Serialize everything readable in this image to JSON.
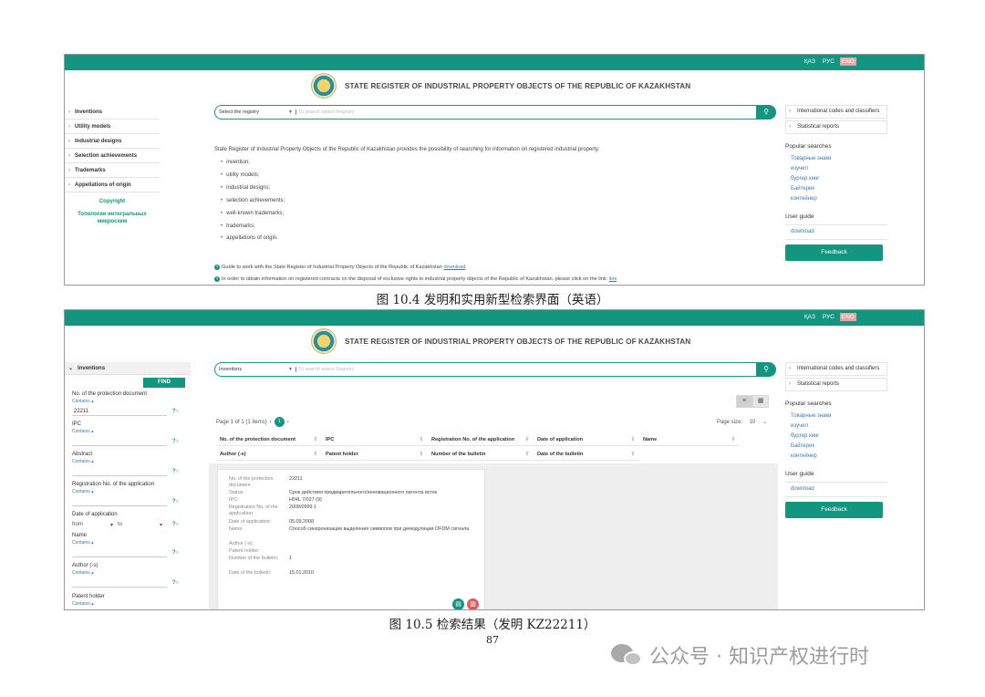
{
  "common": {
    "languages": [
      "ҚАЗ",
      "РУС",
      "ENG"
    ],
    "site_title": "STATE REGISTER OF INDUSTRIAL PROPERTY OBJECTS OF THE REPUBLIC OF KAZAKHSTAN",
    "search_button_icon": "search-icon",
    "right": {
      "box1": "International codes and classifiers",
      "box2": "Statistical reports",
      "popular_title": "Popular searches",
      "popular": [
        "Товарные знаки",
        "изучил",
        "бургер кинг",
        "Байтерек",
        "контейнер"
      ],
      "guide_title": "User guide",
      "download": "download",
      "feedback": "Feedback"
    }
  },
  "shot1": {
    "sidebar": [
      "Inventions",
      "Utility models",
      "Industrial designs",
      "Selection achievements",
      "Trademarks",
      "Appellations of origin"
    ],
    "copyright": "Copyright",
    "topology": "Топологии интегральных микросхем",
    "select_label": "Select the registry",
    "search_placeholder": "To search select Registry",
    "intro": "State Register of Industrial Property Objects of the Republic of Kazakhstan provides the possibility of searching for information on registered industrial property:",
    "list": [
      "invention;",
      "utility models;",
      "industrial designs;",
      "selection achievements;",
      "well-known trademarks;",
      "trademarks;",
      "appellations of origin."
    ],
    "note1": "Guide to work with the State Register of Industrial Property Objects of the Republic of Kazakhstan",
    "note1_link": "download",
    "note2": "In order to obtain information on registered contracts on the disposal of exclusive rights to industrial property objects of the Republic of Kazakhstan, please click on the link:",
    "note2_link": "link"
  },
  "caption1": "图 10.4  发明和实用新型检索界面（英语）",
  "shot2": {
    "panel_title": "Inventions",
    "find": "FIND",
    "filters": {
      "doc_label": "No. of the protection document",
      "contains": "Contains ▴",
      "doc_value": "22211",
      "ipc": "IPC",
      "abstract": "Abstract",
      "reg_no": "Registration No. of the application",
      "date_app": "Date of application",
      "from": "from",
      "to": "to",
      "name": "Name",
      "author": "Author (-s)",
      "holder": "Patent holder"
    },
    "select_value": "Inventions",
    "search_placeholder": "To search select Registry",
    "pager": {
      "text": "Page 1 of 1 (1 items)",
      "current": "1",
      "page_size_label": "Page size:",
      "page_size": "10"
    },
    "columns_row1": [
      "No. of the protection document",
      "IPC",
      "Registration No. of the application",
      "Date of application",
      "Name"
    ],
    "columns_row2": [
      "Author (-s)",
      "Patent holder",
      "Number of the bulletin",
      "Date of the bulletin"
    ],
    "card": [
      {
        "k": "No. of the protection document",
        "v": "22211"
      },
      {
        "k": "Status:",
        "v": "Срок действия предварительного/инновационного патента истек"
      },
      {
        "k": "IPC:",
        "v": "H04L 7/027 (9)"
      },
      {
        "k": "Registration No. of the application:",
        "v": "2008/0999.1"
      },
      {
        "k": "Date of application:",
        "v": "05.09.2008"
      },
      {
        "k": "Name:",
        "v": "Способ синхронизации выделения символов при демодуляции OFDM сигнала"
      },
      {
        "k": "Author (-s):",
        "v": ""
      },
      {
        "k": "Patent holder:",
        "v": ""
      },
      {
        "k": "Number of the bulletin:",
        "v": "1"
      },
      {
        "k": "Date of the bulletin:",
        "v": "15.01.2010"
      }
    ]
  },
  "caption2": "图 10.5  检索结果（发明 KZ22211）",
  "page_number": "87",
  "watermark": "公众号 · 知识产权进行时"
}
